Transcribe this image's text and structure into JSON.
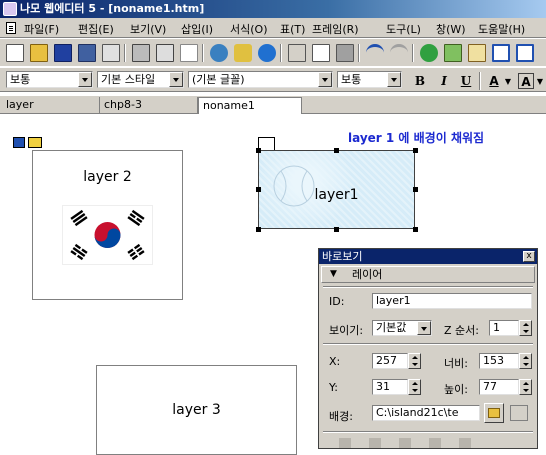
{
  "window": {
    "title": "나모 웹에디터 5 - [noname1.htm]"
  },
  "menu": {
    "items": [
      "파일(F)",
      "편집(E)",
      "보기(V)",
      "삽입(I)",
      "서식(O)",
      "표(T)",
      "프레임(R)",
      "도구(L)",
      "창(W)",
      "도움말(H)"
    ]
  },
  "toolbar": {
    "icons": [
      "new-file-icon",
      "open-folder-icon",
      "save-icon",
      "save-all-icon",
      "preview-icon",
      "print-icon",
      "print-preview-icon",
      "spell-check-icon",
      "globe-icon",
      "sparkle-icon",
      "ie-icon",
      "cut-icon",
      "copy-icon",
      "paste-icon",
      "undo-icon",
      "redo-icon",
      "tree-icon",
      "image-icon",
      "edit-icon",
      "table-icon",
      "frame-icon"
    ]
  },
  "format": {
    "paragraph": "보통",
    "style": "기본 스타일",
    "font": "(기본 글꼴)",
    "size": "보통",
    "bold": "B",
    "italic": "I",
    "underline": "U",
    "font_color": "A",
    "bg_color": "A"
  },
  "tabs": [
    {
      "label": "layer",
      "active": false
    },
    {
      "label": "chp8-3",
      "active": false
    },
    {
      "label": "noname1",
      "active": true
    }
  ],
  "canvas": {
    "annotation": "layer 1 에 배경이 채워짐",
    "layer1_label": "layer1",
    "layer2_label": "layer 2",
    "layer3_label": "layer 3"
  },
  "colors": {
    "annotation": "#1c2ad0",
    "title_bar": "#0a246a",
    "layer1_bg": "#d6ecf8"
  },
  "panel": {
    "title": "바로보기",
    "close": "x",
    "section": "레이어",
    "id_label": "ID:",
    "id_value": "layer1",
    "visible_label": "보이기:",
    "visible_value": "기본값",
    "z_label": "Z 순서:",
    "z_value": "1",
    "x_label": "X:",
    "x_value": "257",
    "width_label": "너비:",
    "width_value": "153",
    "y_label": "Y:",
    "y_value": "31",
    "height_label": "높이:",
    "height_value": "77",
    "bg_label": "배경:",
    "bg_value": "C:\\island21c\\te"
  }
}
